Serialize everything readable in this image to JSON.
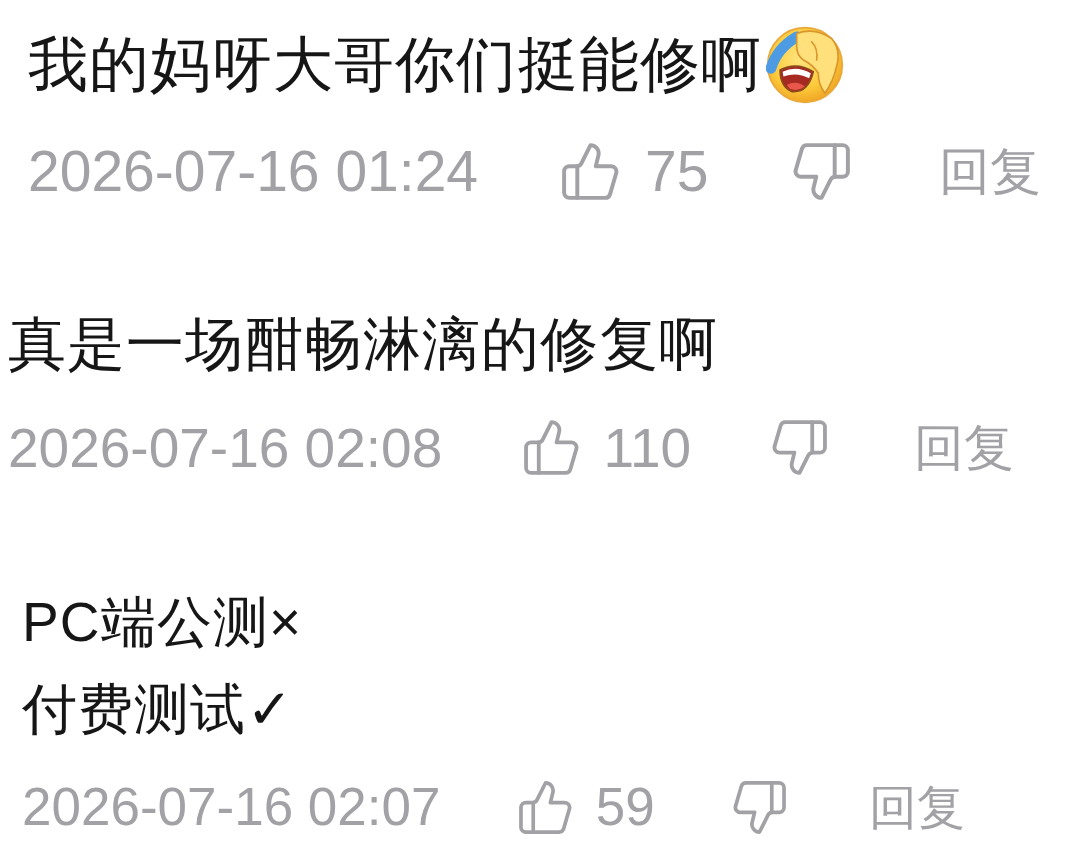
{
  "comments": [
    {
      "lines": [
        "我的妈呀大哥你们挺能修啊"
      ],
      "emoji": true,
      "time": "2026-07-16 01:24",
      "likes": "75",
      "reply": "回复"
    },
    {
      "lines": [
        "真是一场酣畅淋漓的修复啊"
      ],
      "emoji": false,
      "time": "2026-07-16 02:08",
      "likes": "110",
      "reply": "回复"
    },
    {
      "lines": [
        "PC端公测×",
        "付费测试✓"
      ],
      "emoji": false,
      "time": "2026-07-16 02:07",
      "likes": "59",
      "reply": "回复"
    }
  ]
}
